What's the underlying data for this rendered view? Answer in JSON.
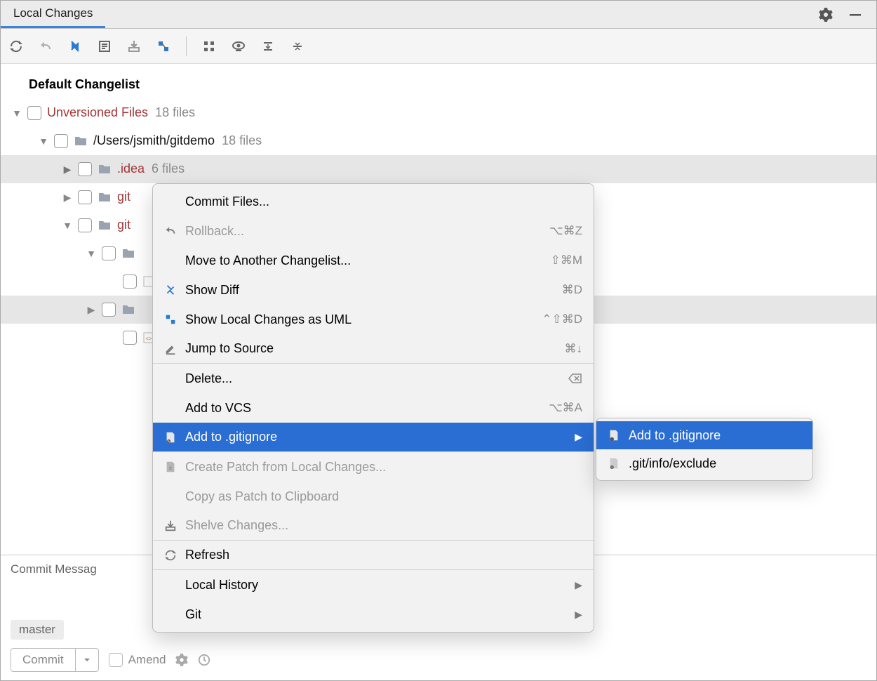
{
  "tab": {
    "label": "Local Changes"
  },
  "tree": {
    "root_label": "Default Changelist",
    "unversioned": {
      "label": "Unversioned Files",
      "count": "18 files"
    },
    "path": {
      "label": "/Users/jsmith/gitdemo",
      "count": "18 files"
    },
    "idea": {
      "label": ".idea",
      "count": "6 files"
    },
    "trunc1": {
      "label": "git"
    },
    "trunc2": {
      "label": "git"
    }
  },
  "context_menu": {
    "commit_files": "Commit Files...",
    "rollback": "Rollback...",
    "rollback_sc": "⌥⌘Z",
    "move_cl": "Move to Another Changelist...",
    "move_cl_sc": "⇧⌘M",
    "show_diff": "Show Diff",
    "show_diff_sc": "⌘D",
    "show_uml": "Show Local Changes as UML",
    "show_uml_sc": "⌃⇧⌘D",
    "jump_source": "Jump to Source",
    "jump_source_sc": "⌘↓",
    "delete": "Delete...",
    "delete_sc": "⌦",
    "add_vcs": "Add to VCS",
    "add_vcs_sc": "⌥⌘A",
    "add_gitignore": "Add to .gitignore",
    "create_patch": "Create Patch from Local Changes...",
    "copy_patch": "Copy as Patch to Clipboard",
    "shelve": "Shelve Changes...",
    "refresh": "Refresh",
    "local_history": "Local History",
    "git": "Git"
  },
  "sub_menu": {
    "add_gitignore": "Add to .gitignore",
    "git_exclude": ".git/info/exclude"
  },
  "bottom": {
    "commit_message_label": "Commit Messag",
    "branch": "master",
    "commit_button": "Commit",
    "amend_label": "Amend"
  }
}
